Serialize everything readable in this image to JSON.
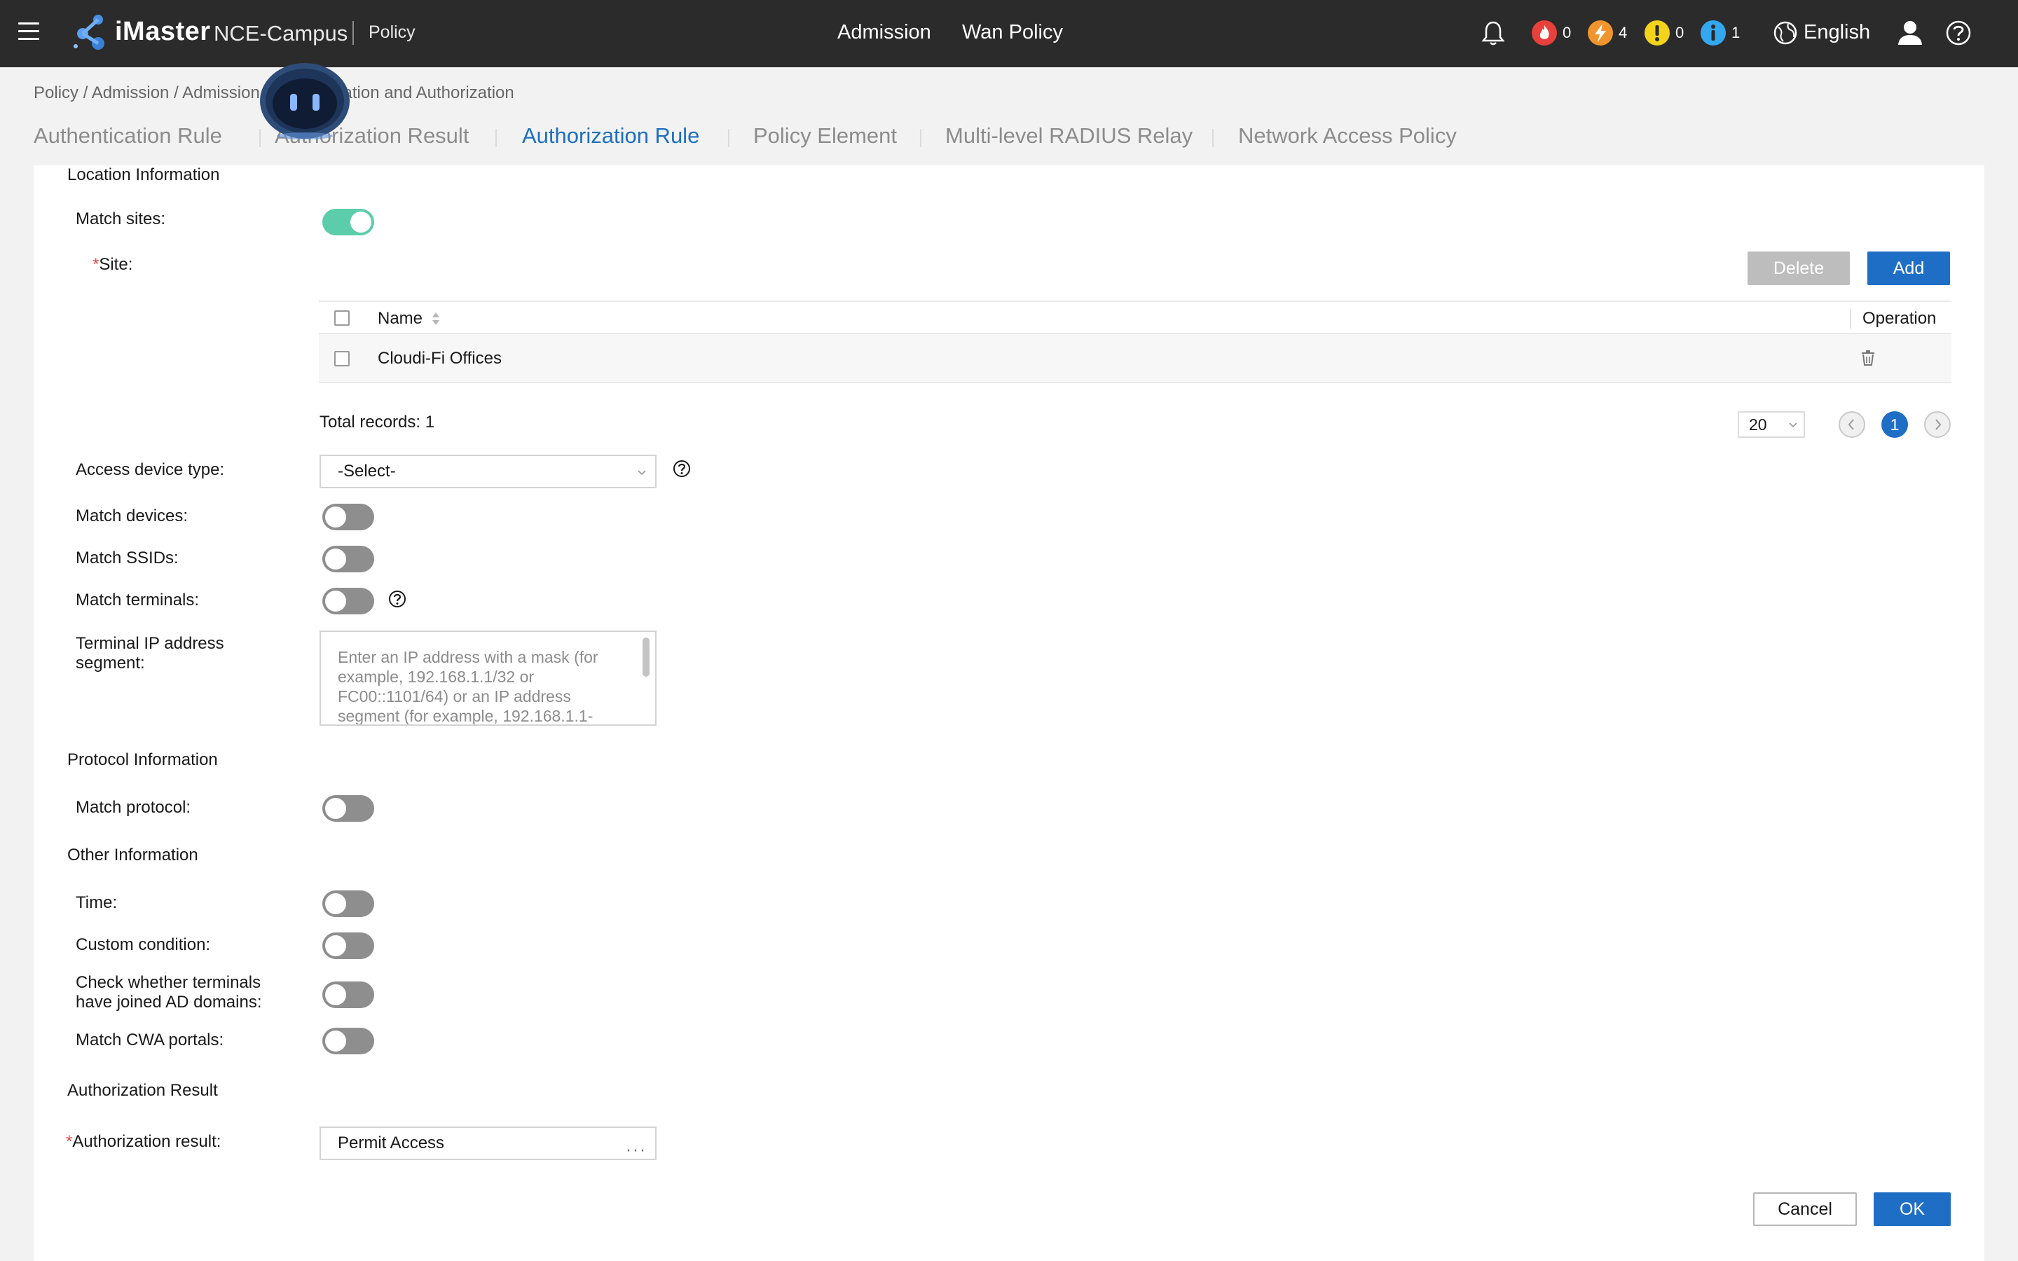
{
  "header": {
    "brand": "iMaster",
    "product": "NCE-Campus",
    "module": "Policy",
    "nav": [
      "Admission",
      "Wan Policy"
    ],
    "alarms": {
      "critical": "0",
      "major": "4",
      "minor": "0",
      "info": "1",
      "colors": {
        "critical": "#e8403a",
        "major": "#f0952e",
        "minor": "#f4d31b",
        "info": "#33a8f0"
      }
    },
    "language": "English",
    "icons": [
      "menu-icon",
      "logo-icon",
      "bell-icon",
      "globe-icon",
      "user-icon",
      "help-icon"
    ]
  },
  "breadcrumb": "Policy / Admission / Admission  /  Authentication and Authorization",
  "tabs": [
    {
      "label": "Authentication Rule"
    },
    {
      "label": "Authorization Result"
    },
    {
      "label": "Authorization Rule"
    },
    {
      "label": "Policy Element"
    },
    {
      "label": "Multi-level RADIUS Relay"
    },
    {
      "label": "Network Access Policy"
    }
  ],
  "active_tab": "Authorization Rule",
  "location": {
    "title": "Location Information",
    "match_sites_label": "Match sites:",
    "match_sites_on": true,
    "site_label": "Site:",
    "required_mark": "*",
    "delete_label": "Delete",
    "add_label": "Add",
    "table": {
      "col_name": "Name",
      "col_operation": "Operation",
      "rows": [
        {
          "name": "Cloudi-Fi Offices"
        }
      ]
    },
    "total_records": "Total records: 1",
    "page_size": "20",
    "current_page": "1",
    "access_device_type_label": "Access device type:",
    "access_device_type_value": "-Select-",
    "match_devices_label": "Match devices:",
    "match_ssids_label": "Match SSIDs:",
    "match_terminals_label": "Match terminals:",
    "terminal_ip_label_1": "Terminal IP address",
    "terminal_ip_label_2": "segment:",
    "terminal_ip_placeholder_lines": [
      "Enter an IP address with a mask (for",
      "example, 192.168.1.1/32 or",
      "FC00::1101/64) or an IP address",
      "segment (for example, 192.168.1.1-"
    ]
  },
  "protocol": {
    "title": "Protocol Information",
    "match_protocol_label": "Match protocol:"
  },
  "other": {
    "title": "Other Information",
    "time_label": "Time:",
    "custom_condition_label": "Custom condition:",
    "ad_domain_label_1": "Check whether terminals",
    "ad_domain_label_2": "have joined AD domains:",
    "cwa_label": "Match CWA portals:"
  },
  "result": {
    "title": "Authorization Result",
    "label": "Authorization result:",
    "value": "Permit Access",
    "more": "···"
  },
  "footer": {
    "cancel_label": "Cancel",
    "ok_label": "OK"
  },
  "colors": {
    "accent": "#1f6ec6",
    "toggle_on": "#5ccdaa",
    "toggle_off": "#8e8e8e",
    "header_bg": "#2b2b2b"
  }
}
